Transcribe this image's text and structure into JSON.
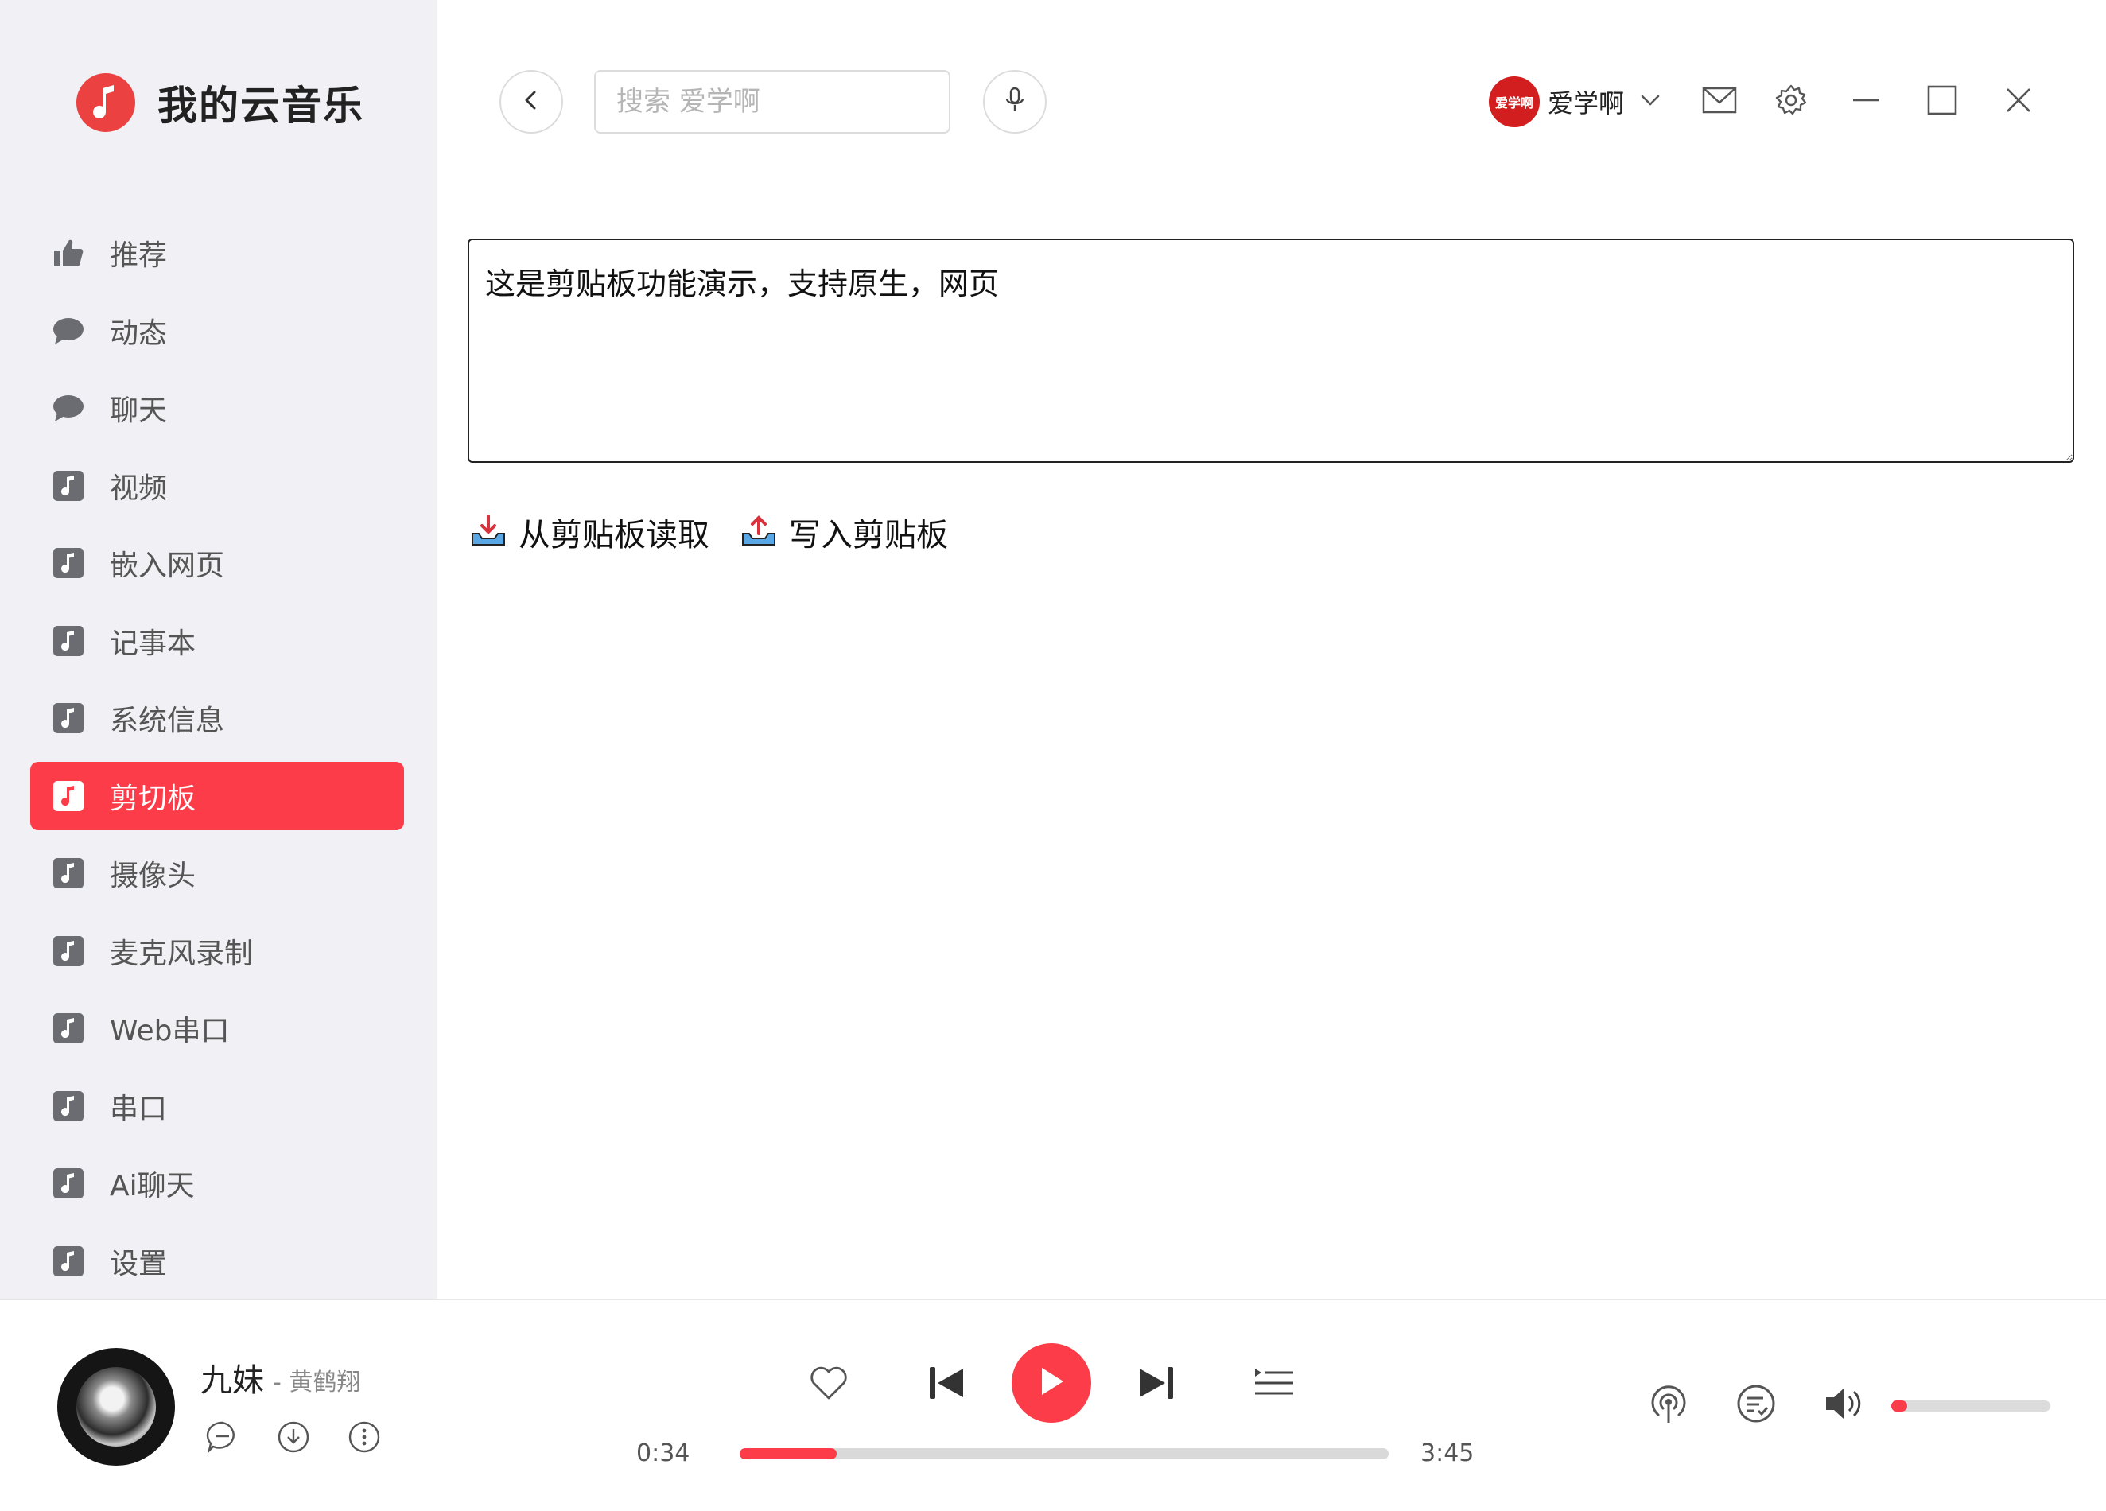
{
  "app": {
    "name": "我的云音乐",
    "logo_icon": "music-note-icon",
    "accent_color": "#fc3d49"
  },
  "sidebar": {
    "items": [
      {
        "label": "推荐",
        "icon": "thumbs-up-icon",
        "active": false
      },
      {
        "label": "动态",
        "icon": "chat-bubble-icon",
        "active": false
      },
      {
        "label": "聊天",
        "icon": "chat-bubble-icon",
        "active": false
      },
      {
        "label": "视频",
        "icon": "music-note-icon",
        "active": false
      },
      {
        "label": "嵌入网页",
        "icon": "music-note-icon",
        "active": false
      },
      {
        "label": "记事本",
        "icon": "music-note-icon",
        "active": false
      },
      {
        "label": "系统信息",
        "icon": "music-note-icon",
        "active": false
      },
      {
        "label": "剪切板",
        "icon": "music-note-icon",
        "active": true
      },
      {
        "label": "摄像头",
        "icon": "music-note-icon",
        "active": false
      },
      {
        "label": "麦克风录制",
        "icon": "music-note-icon",
        "active": false
      },
      {
        "label": "Web串口",
        "icon": "music-note-icon",
        "active": false
      },
      {
        "label": "串口",
        "icon": "music-note-icon",
        "active": false
      },
      {
        "label": "Ai聊天",
        "icon": "music-note-icon",
        "active": false
      },
      {
        "label": "设置",
        "icon": "music-note-icon",
        "active": false
      }
    ]
  },
  "header": {
    "search_placeholder": "搜索 爱学啊",
    "user": {
      "avatar_text": "爱学啊",
      "name": "爱学啊"
    }
  },
  "main": {
    "clipboard_text": "这是剪贴板功能演示，支持原生，网页",
    "read_button": "从剪贴板读取",
    "write_button": "写入剪贴板"
  },
  "player": {
    "song_title": "九妹",
    "song_artist": "- 黄鹤翔",
    "current_time": "0:34",
    "total_time": "3:45",
    "progress_fraction": 0.15,
    "volume_fraction": 0.1
  }
}
